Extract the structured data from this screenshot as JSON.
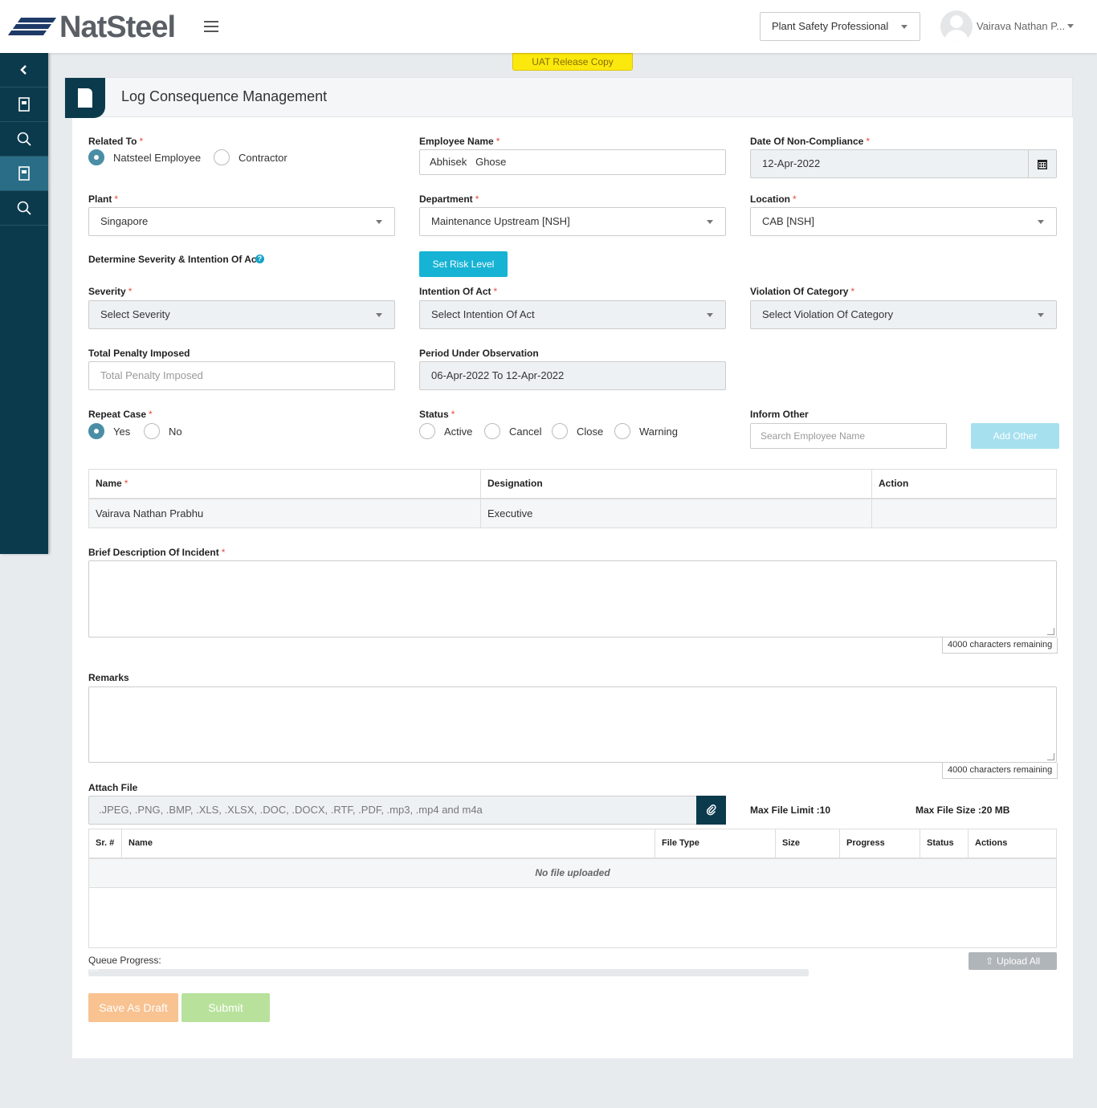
{
  "header": {
    "logo_text": "NatSteel",
    "role": "Plant Safety Professional",
    "user": "Vairava Nathan P..."
  },
  "uat_badge": "UAT Release Copy",
  "page_title": "Log Consequence Management",
  "form": {
    "related_to": {
      "label": "Related To",
      "options": [
        "Natsteel Employee",
        "Contractor"
      ],
      "selected": "Natsteel Employee"
    },
    "employee_name": {
      "label": "Employee Name",
      "value": "Abhisek   Ghose"
    },
    "date_non_compliance": {
      "label": "Date Of Non-Compliance",
      "value": "12-Apr-2022"
    },
    "plant": {
      "label": "Plant",
      "value": "Singapore"
    },
    "department": {
      "label": "Department",
      "value": "Maintenance Upstream [NSH]"
    },
    "location": {
      "label": "Location",
      "value": "CAB [NSH]"
    },
    "severity_section": {
      "label": "Determine Severity & Intention Of Act",
      "button": "Set Risk Level"
    },
    "severity": {
      "label": "Severity",
      "value": "Select Severity"
    },
    "intention": {
      "label": "Intention Of Act",
      "value": "Select Intention Of Act"
    },
    "violation": {
      "label": "Violation Of Category",
      "value": "Select Violation Of Category"
    },
    "penalty": {
      "label": "Total Penalty Imposed",
      "placeholder": "Total Penalty Imposed"
    },
    "period": {
      "label": "Period Under Observation",
      "value": "06-Apr-2022 To 12-Apr-2022"
    },
    "repeat_case": {
      "label": "Repeat Case",
      "options": [
        "Yes",
        "No"
      ],
      "selected": "Yes"
    },
    "status": {
      "label": "Status",
      "options": [
        "Active",
        "Cancel",
        "Close",
        "Warning"
      ]
    },
    "inform_other": {
      "label": "Inform Other",
      "placeholder": "Search Employee Name",
      "button": "Add Other"
    }
  },
  "inform_table": {
    "headers": [
      "Name",
      "Designation",
      "Action"
    ],
    "rows": [
      {
        "name": "Vairava Nathan Prabhu",
        "designation": "Executive",
        "action": ""
      }
    ]
  },
  "description": {
    "label": "Brief Description Of Incident",
    "counter": "4000 characters remaining"
  },
  "remarks": {
    "label": "Remarks",
    "counter": "4000 characters remaining"
  },
  "attach": {
    "label": "Attach File",
    "placeholder": ".JPEG, .PNG, .BMP, .XLS, .XLSX, .DOC, .DOCX, .RTF, .PDF, .mp3, .mp4 and m4a",
    "max_limit": "Max File Limit :10",
    "max_size": "Max File Size :20 MB"
  },
  "file_table": {
    "headers": [
      "Sr. #",
      "Name",
      "File Type",
      "Size",
      "Progress",
      "Status",
      "Actions"
    ],
    "empty": "No file uploaded"
  },
  "queue": {
    "label": "Queue Progress:",
    "progress_percent": 0,
    "progress_text": "0%",
    "upload_all": "Upload All"
  },
  "actions": {
    "save_draft": "Save As Draft",
    "submit": "Submit"
  },
  "colors": {
    "sidebar": "#0c3a4d",
    "accent": "#17b3d4",
    "save": "#f8c291",
    "submit": "#b8e29c"
  }
}
